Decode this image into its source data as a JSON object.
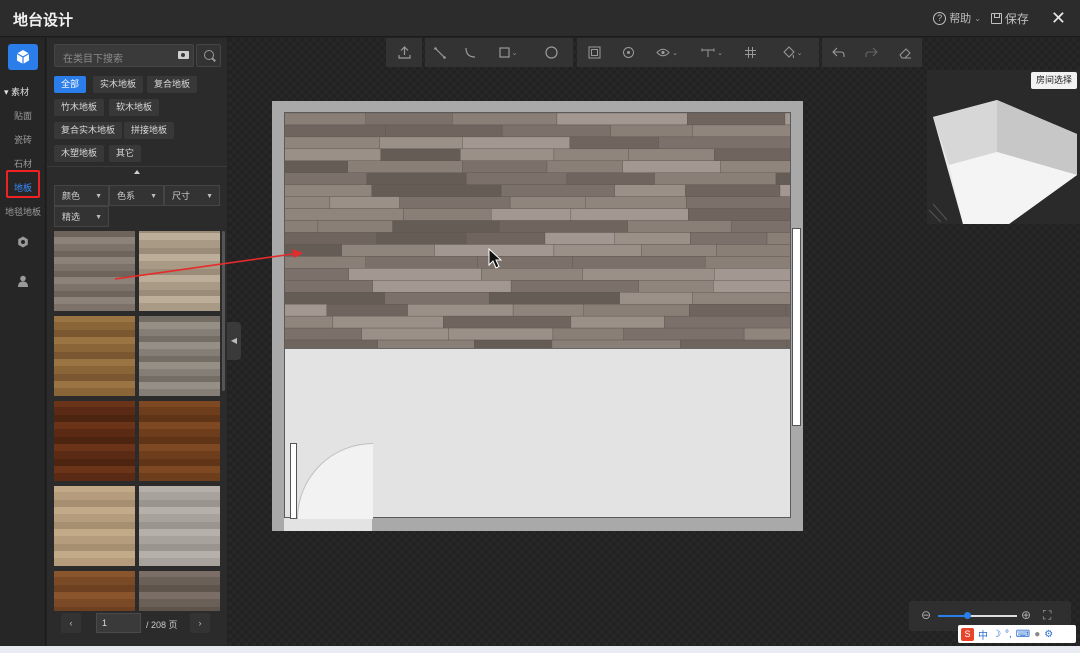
{
  "app": {
    "title": "地台设计",
    "help_label": "帮助",
    "save_label": "保存",
    "close_glyph": "✕"
  },
  "sidebar": {
    "section_label": "▾ 素材",
    "items": [
      {
        "label": "贴面"
      },
      {
        "label": "瓷砖"
      },
      {
        "label": "石材"
      },
      {
        "label": "地板",
        "active": true
      },
      {
        "label": "地毯地板"
      }
    ],
    "icons": [
      "cube-icon",
      "settings-icon",
      "user-icon"
    ]
  },
  "panel": {
    "search_placeholder": "在类目下搜索",
    "categories": [
      {
        "label": "全部",
        "active": true
      },
      {
        "label": "实木地板"
      },
      {
        "label": "复合地板"
      },
      {
        "label": "竹木地板"
      },
      {
        "label": "软木地板"
      },
      {
        "label": "复合实木地板"
      },
      {
        "label": "拼接地板"
      },
      {
        "label": "木塑地板"
      },
      {
        "label": "其它"
      }
    ],
    "filters": [
      {
        "label": "颜色"
      },
      {
        "label": "色系"
      },
      {
        "label": "尺寸"
      },
      {
        "label": "精选"
      }
    ],
    "thumbnail_count_visible": 12,
    "pagination": {
      "current_page": "1",
      "total_label": "/ 208 页",
      "prev": "‹",
      "next": "›"
    }
  },
  "canvas": {
    "room_select_label": "房间选择",
    "toolbar_icons": [
      "upload-icon",
      "line-tool-icon",
      "arc-tool-icon",
      "rect-tool-icon",
      "circle-tool-icon",
      "fit-icon",
      "area-icon",
      "eye-icon",
      "dimension-icon",
      "grid-icon",
      "paint-icon",
      "undo-icon",
      "redo-icon",
      "eraser-icon"
    ]
  },
  "colors": {
    "accent": "#2b7de9",
    "highlight": "#ee2222",
    "background": "#232323"
  },
  "ime": {
    "label": "中"
  }
}
